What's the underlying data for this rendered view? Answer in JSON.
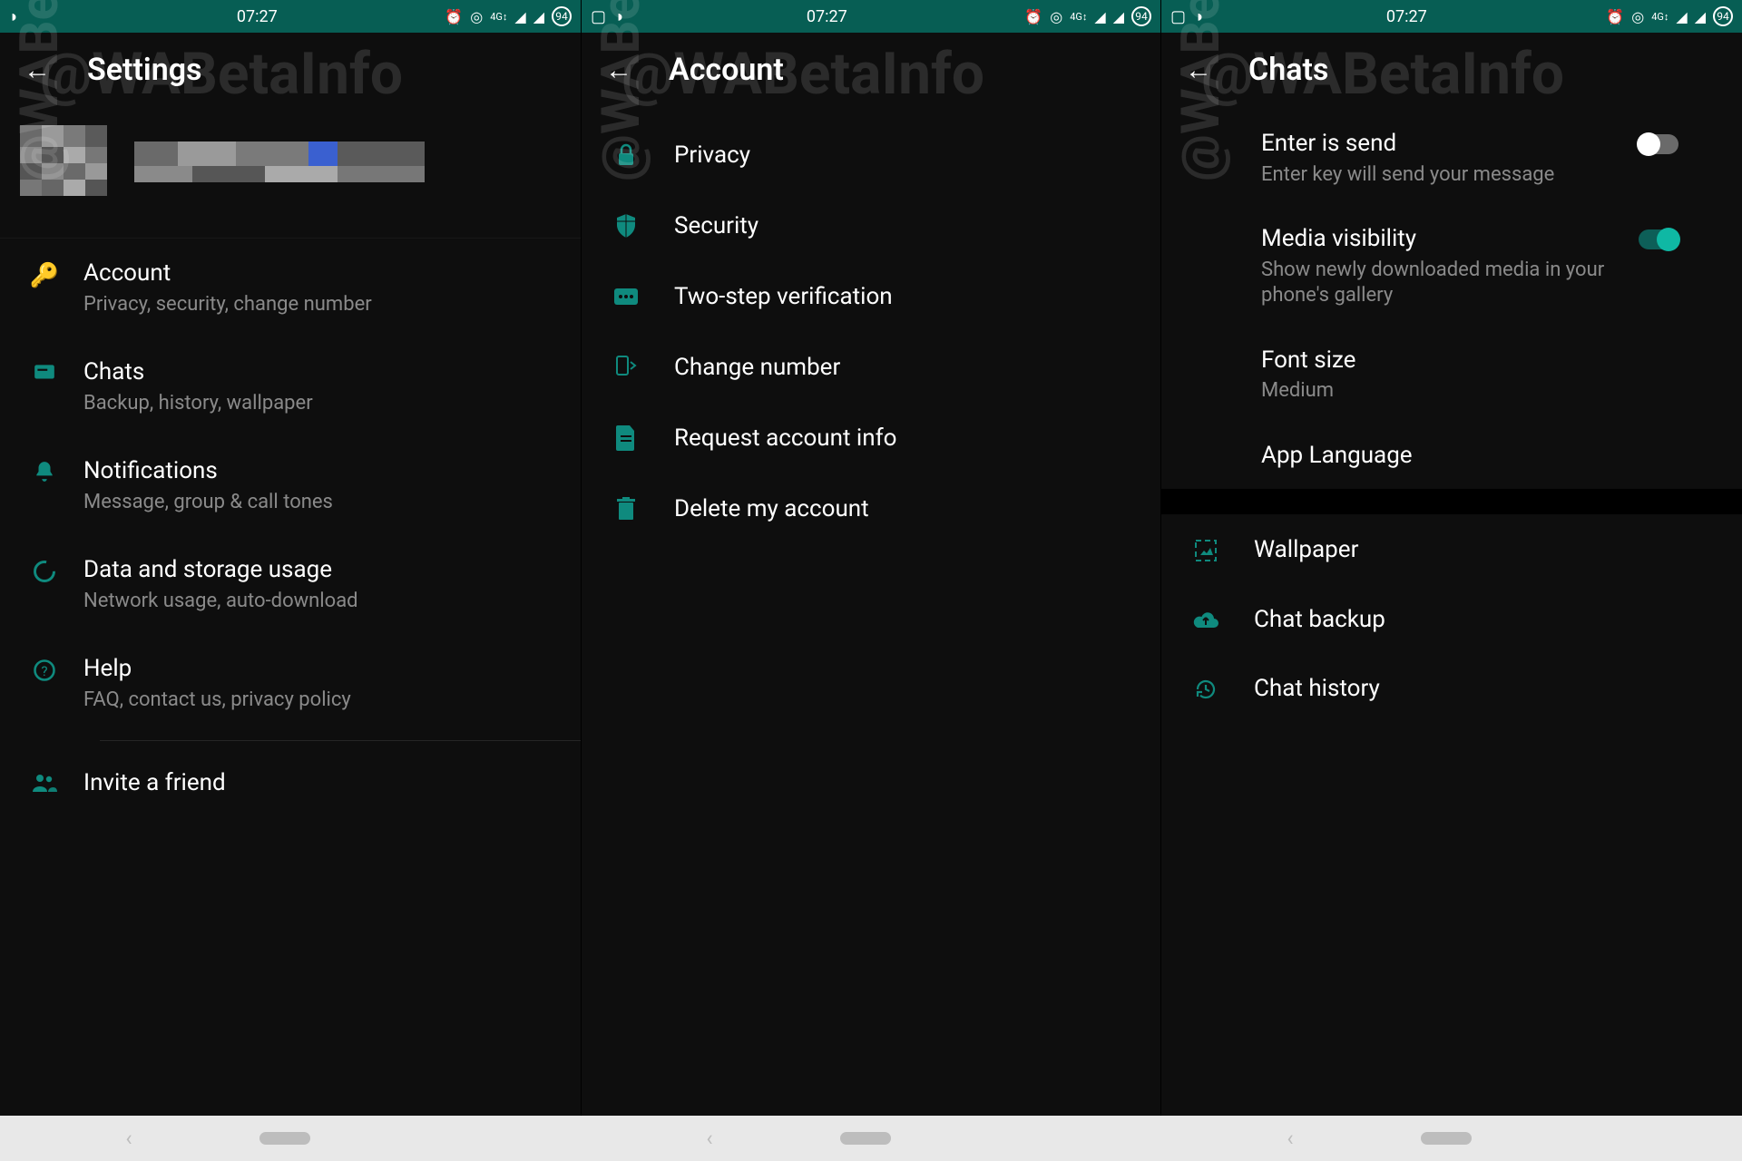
{
  "statusbar": {
    "time": "07:27",
    "battery_badge": "94"
  },
  "watermark": "@WABetaInfo",
  "screen1": {
    "title": "Settings",
    "items": [
      {
        "title": "Account",
        "sub": "Privacy, security, change number"
      },
      {
        "title": "Chats",
        "sub": "Backup, history, wallpaper"
      },
      {
        "title": "Notifications",
        "sub": "Message, group & call tones"
      },
      {
        "title": "Data and storage usage",
        "sub": "Network usage, auto-download"
      },
      {
        "title": "Help",
        "sub": "FAQ, contact us, privacy policy"
      }
    ],
    "invite": "Invite a friend"
  },
  "screen2": {
    "title": "Account",
    "items": [
      "Privacy",
      "Security",
      "Two-step verification",
      "Change number",
      "Request account info",
      "Delete my account"
    ]
  },
  "screen3": {
    "title": "Chats",
    "toggle_items": [
      {
        "title": "Enter is send",
        "sub": "Enter key will send your message",
        "on": false
      },
      {
        "title": "Media visibility",
        "sub": "Show newly downloaded media in your phone's gallery",
        "on": true
      }
    ],
    "font_size": {
      "title": "Font size",
      "value": "Medium"
    },
    "app_language": "App Language",
    "rows": [
      "Wallpaper",
      "Chat backup",
      "Chat history"
    ]
  }
}
